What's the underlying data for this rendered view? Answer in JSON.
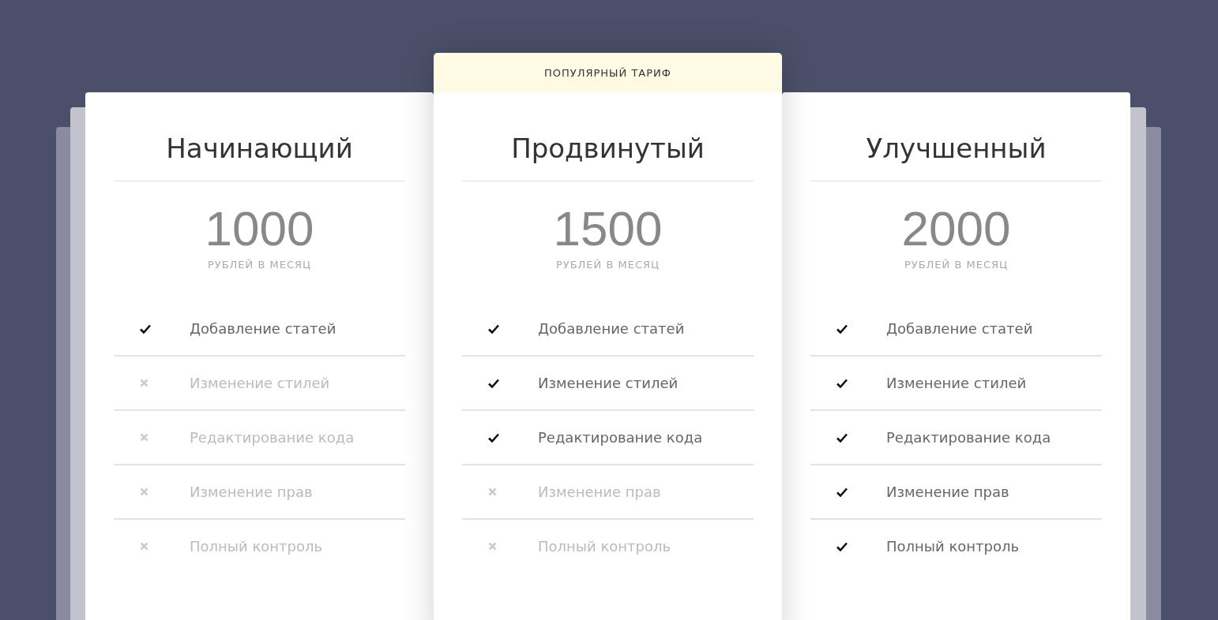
{
  "plans": [
    {
      "title": "Начинающий",
      "price": "1000",
      "period": "РУБЛЕЙ В МЕСЯЦ",
      "features": [
        {
          "label": "Добавление статей",
          "included": true
        },
        {
          "label": "Изменение стилей",
          "included": false
        },
        {
          "label": "Редактирование кода",
          "included": false
        },
        {
          "label": "Изменение прав",
          "included": false
        },
        {
          "label": "Полный контроль",
          "included": false
        }
      ]
    },
    {
      "title": "Продвинутый",
      "price": "1500",
      "period": "РУБЛЕЙ В МЕСЯЦ",
      "badge": "ПОПУЛЯРНЫЙ ТАРИФ",
      "features": [
        {
          "label": "Добавление статей",
          "included": true
        },
        {
          "label": "Изменение стилей",
          "included": true
        },
        {
          "label": "Редактирование кода",
          "included": true
        },
        {
          "label": "Изменение прав",
          "included": false
        },
        {
          "label": "Полный контроль",
          "included": false
        }
      ]
    },
    {
      "title": "Улучшенный",
      "price": "2000",
      "period": "РУБЛЕЙ В МЕСЯЦ",
      "features": [
        {
          "label": "Добавление статей",
          "included": true
        },
        {
          "label": "Изменение стилей",
          "included": true
        },
        {
          "label": "Редактирование кода",
          "included": true
        },
        {
          "label": "Изменение прав",
          "included": true
        },
        {
          "label": "Полный контроль",
          "included": true
        }
      ]
    }
  ]
}
